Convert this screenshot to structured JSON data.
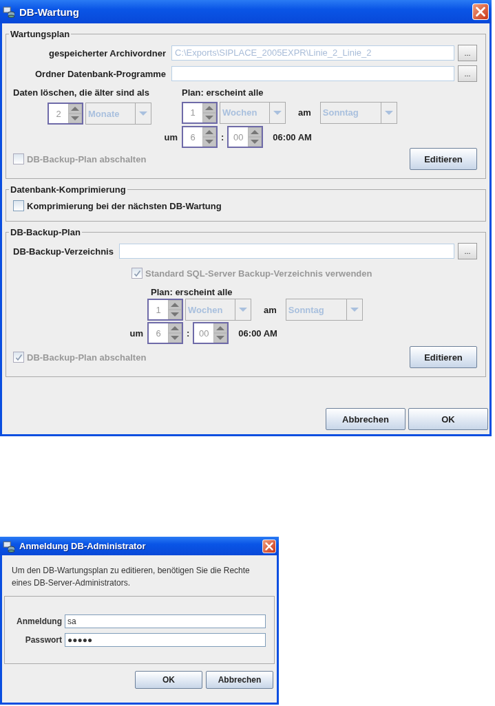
{
  "main_dialog": {
    "title": "DB-Wartung",
    "maintenance_plan": {
      "legend": "Wartungsplan",
      "paths": [
        {
          "label": "gespeicherter Archivordner",
          "value": "C:\\Exports\\SIPLACE_2005EXPR\\Linie_2_Linie_2",
          "disabled": true,
          "browse": "..."
        },
        {
          "label": "Ordner Datenbank-Programme",
          "disabled": true,
          "browse": "..."
        }
      ],
      "delete_label": "Daten löschen, die älter sind als",
      "retention": {
        "value": "2",
        "unit": "Monate"
      },
      "schedule": {
        "label": "Plan: erscheint alle",
        "interval": "1",
        "unit": "Wochen",
        "day_label": "am",
        "day": "Sonntag",
        "time_label": "um",
        "hour": "6",
        "separator": ":",
        "minute": "00",
        "time_text": "06:00 AM"
      },
      "disable_checkbox": {
        "label": "DB-Backup-Plan abschalten",
        "checked": false,
        "disabled": true
      },
      "edit_button": "Editieren"
    },
    "compression": {
      "legend": "Datenbank-Komprimierung",
      "checkbox": {
        "label": "Komprimierung bei der nächsten DB-Wartung",
        "checked": false,
        "disabled": false
      }
    },
    "backup_plan": {
      "legend": "DB-Backup-Plan",
      "directory_label": "DB-Backup-Verzeichnis",
      "directory_disabled": false,
      "browse": "...",
      "default_checkbox": {
        "label": "Standard SQL-Server Backup-Verzeichnis verwenden",
        "checked": true,
        "disabled": true
      },
      "schedule": {
        "label": "Plan: erscheint alle",
        "interval": "1",
        "unit": "Wochen",
        "day_label": "am",
        "day": "Sonntag",
        "time_label": "um",
        "hour": "6",
        "separator": ":",
        "minute": "00",
        "time_text": "06:00 AM"
      },
      "disable_checkbox": {
        "label": "DB-Backup-Plan abschalten",
        "checked": true,
        "disabled": true
      },
      "edit_button": "Editieren"
    },
    "buttons": [
      "Abbrechen",
      "OK"
    ]
  },
  "login_dialog": {
    "title": "Anmeldung DB-Administrator",
    "message_lines": [
      "Um den DB-Wartungsplan zu editieren, benötigen Sie die Rechte",
      "eines DB-Server-Administrators."
    ],
    "fields": [
      {
        "label": "Anmeldung",
        "value": "sa"
      },
      {
        "label": "Passwort",
        "value": "●●●●●"
      }
    ],
    "buttons": [
      "OK",
      "Abbrechen"
    ]
  }
}
